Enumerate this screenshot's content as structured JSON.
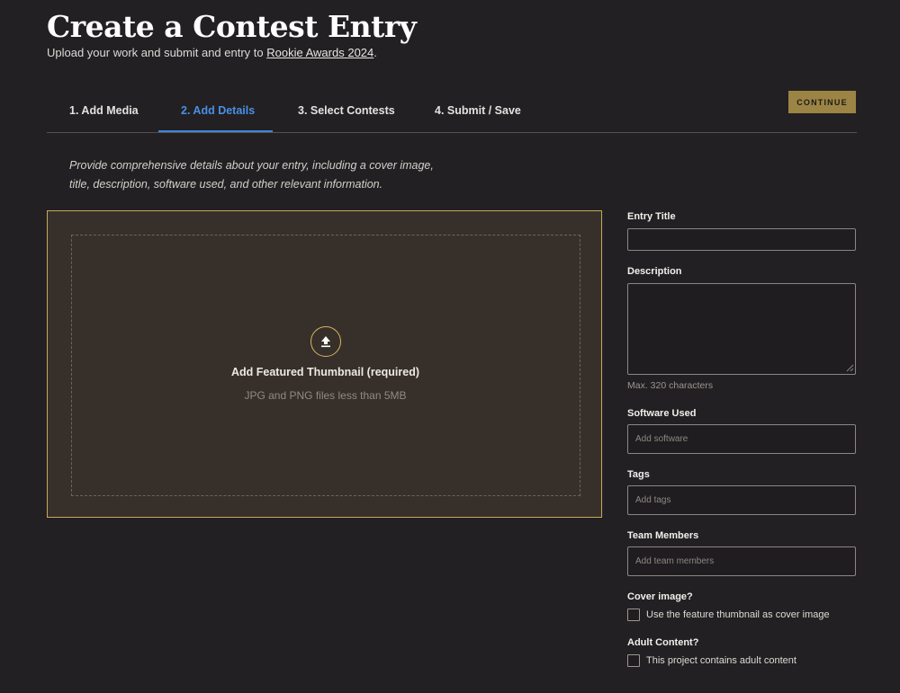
{
  "header": {
    "title": "Create a Contest Entry",
    "subtitle_prefix": "Upload your work and submit and entry to ",
    "subtitle_link": "Rookie Awards 2024",
    "subtitle_suffix": "."
  },
  "tabs": [
    {
      "label": "1. Add Media",
      "active": false
    },
    {
      "label": "2. Add Details",
      "active": true
    },
    {
      "label": "3. Select Contests",
      "active": false
    },
    {
      "label": "4. Submit / Save",
      "active": false
    }
  ],
  "continue_label": "CONTINUE",
  "intro_text": "Provide comprehensive details about your entry, including a cover image, title, description, software used, and other relevant information.",
  "dropzone": {
    "icon": "upload-arrow-icon",
    "title": "Add Featured Thumbnail (required)",
    "hint": "JPG and PNG files less than 5MB"
  },
  "form": {
    "entry_title": {
      "label": "Entry Title",
      "value": "",
      "placeholder": ""
    },
    "description": {
      "label": "Description",
      "value": "",
      "helper": "Max. 320 characters"
    },
    "software": {
      "label": "Software Used",
      "placeholder": "Add software"
    },
    "tags": {
      "label": "Tags",
      "placeholder": "Add tags"
    },
    "team": {
      "label": "Team Members",
      "placeholder": "Add team members"
    },
    "cover": {
      "label": "Cover image?",
      "checkbox_label": "Use the feature thumbnail as cover image",
      "checked": false
    },
    "adult": {
      "label": "Adult Content?",
      "checkbox_label": "This project contains adult content",
      "checked": false
    }
  },
  "colors": {
    "background": "#222022",
    "accent_gold": "#9c8445",
    "active_tab": "#4a8fe6",
    "dropzone_bg": "#37302a"
  }
}
